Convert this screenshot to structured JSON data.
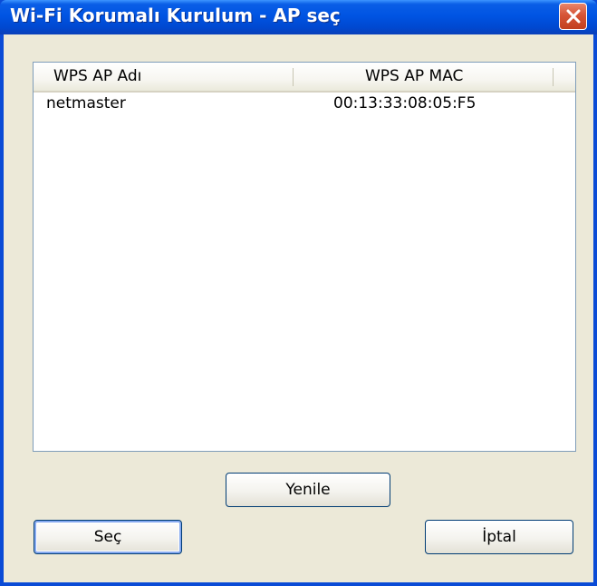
{
  "window": {
    "title": "Wi-Fi Korumalı Kurulum - AP seç"
  },
  "list": {
    "columns": [
      "WPS AP Adı",
      "WPS AP MAC"
    ],
    "rows": [
      {
        "name": "netmaster",
        "mac": "00:13:33:08:05:F5"
      }
    ]
  },
  "buttons": {
    "refresh": "Yenile",
    "select": "Seç",
    "cancel": "İptal"
  },
  "icons": {
    "close": "close-icon"
  },
  "colors": {
    "titlebar": "#0054e3",
    "close_button": "#d65436",
    "dialog_background": "#ece9d8",
    "button_border": "#003c74"
  }
}
